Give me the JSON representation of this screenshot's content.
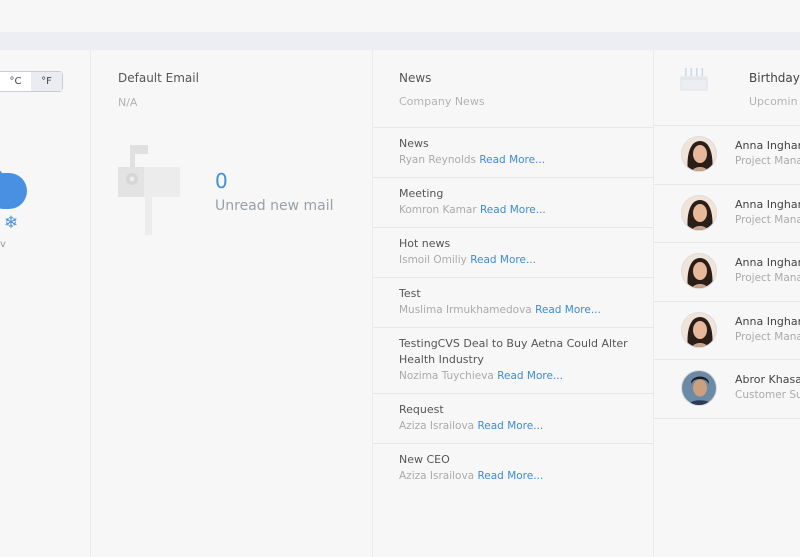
{
  "weather": {
    "unit_c": "°C",
    "unit_f": "°F",
    "cut_label": "v"
  },
  "email": {
    "title": "Default Email",
    "value": "N/A",
    "unread_count": "0",
    "unread_label": "Unread new mail"
  },
  "news": {
    "title": "News",
    "subtitle": "Company News",
    "read_more": "Read More...",
    "items": [
      {
        "title": "News",
        "author": "Ryan Reynolds"
      },
      {
        "title": "Meeting",
        "author": "Komron Kamar"
      },
      {
        "title": "Hot news",
        "author": "Ismoil Omiliy"
      },
      {
        "title": "Test",
        "author": "Muslima Irmukhamedova"
      },
      {
        "title": "TestingCVS Deal to Buy Aetna Could Alter Health Industry",
        "author": "Nozima Tuychieva"
      },
      {
        "title": "Request",
        "author": "Aziza Israilova"
      },
      {
        "title": "New CEO",
        "author": "Aziza Israilova"
      }
    ]
  },
  "birthdays": {
    "title": "Birthday",
    "subtitle": "Upcomin",
    "people": [
      {
        "name": "Anna Inghar",
        "role": "Project Mana",
        "avatar": "female"
      },
      {
        "name": "Anna Inghar",
        "role": "Project Mana",
        "avatar": "female"
      },
      {
        "name": "Anna Inghar",
        "role": "Project Mana",
        "avatar": "female"
      },
      {
        "name": "Anna Inghar",
        "role": "Project Mana",
        "avatar": "female"
      },
      {
        "name": "Abror Khasa",
        "role": "Customer Su",
        "avatar": "male"
      }
    ]
  }
}
